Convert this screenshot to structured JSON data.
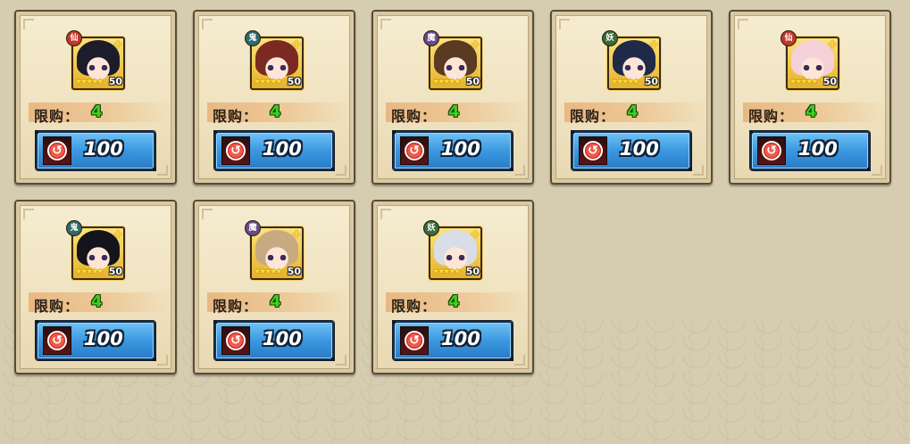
{
  "colors": {
    "background": "#d6ccb0",
    "card": "#efe2bf",
    "button": "#3b98e0",
    "limit_value": "#3bd21c",
    "faction_hexagon_red": "#c0392b",
    "faction_ghost_teal": "#2d6b6b",
    "faction_demon_purple": "#6a4a8a",
    "faction_yao_green": "#3a6b3a"
  },
  "items": [
    {
      "faction": "仙",
      "faction_color": "#c0392b",
      "hair": "#1c1c2a",
      "level": "50",
      "stars": "★★★★★",
      "limit_label": "限购：",
      "limit_value": "4",
      "price": "100",
      "currency_icon": "spiral-coin"
    },
    {
      "faction": "鬼",
      "faction_color": "#2d6b6b",
      "hair": "#7a2a20",
      "level": "50",
      "stars": "★★★★★",
      "limit_label": "限购：",
      "limit_value": "4",
      "price": "100",
      "currency_icon": "spiral-coin"
    },
    {
      "faction": "魔",
      "faction_color": "#6a4a8a",
      "hair": "#5a3a22",
      "level": "50",
      "stars": "★★★★★",
      "limit_label": "限购：",
      "limit_value": "4",
      "price": "100",
      "currency_icon": "spiral-coin"
    },
    {
      "faction": "妖",
      "faction_color": "#3a6b3a",
      "hair": "#1e2a48",
      "level": "50",
      "stars": "★★★★★",
      "limit_label": "限购：",
      "limit_value": "4",
      "price": "100",
      "currency_icon": "spiral-coin"
    },
    {
      "faction": "仙",
      "faction_color": "#c0392b",
      "hair": "#f4d0d8",
      "level": "50",
      "stars": "★★★★★",
      "limit_label": "限购：",
      "limit_value": "4",
      "price": "100",
      "currency_icon": "spiral-coin"
    },
    {
      "faction": "鬼",
      "faction_color": "#2d6b6b",
      "hair": "#14141c",
      "level": "50",
      "stars": "★★★★★",
      "limit_label": "限购：",
      "limit_value": "4",
      "price": "100",
      "currency_icon": "spiral-coin"
    },
    {
      "faction": "魔",
      "faction_color": "#6a4a8a",
      "hair": "#c8aa80",
      "level": "50",
      "stars": "★★★★★",
      "limit_label": "限购：",
      "limit_value": "4",
      "price": "100",
      "currency_icon": "spiral-coin"
    },
    {
      "faction": "妖",
      "faction_color": "#3a6b3a",
      "hair": "#d8dde8",
      "level": "50",
      "stars": "★★★★★",
      "limit_label": "限购：",
      "limit_value": "4",
      "price": "100",
      "currency_icon": "spiral-coin"
    }
  ]
}
